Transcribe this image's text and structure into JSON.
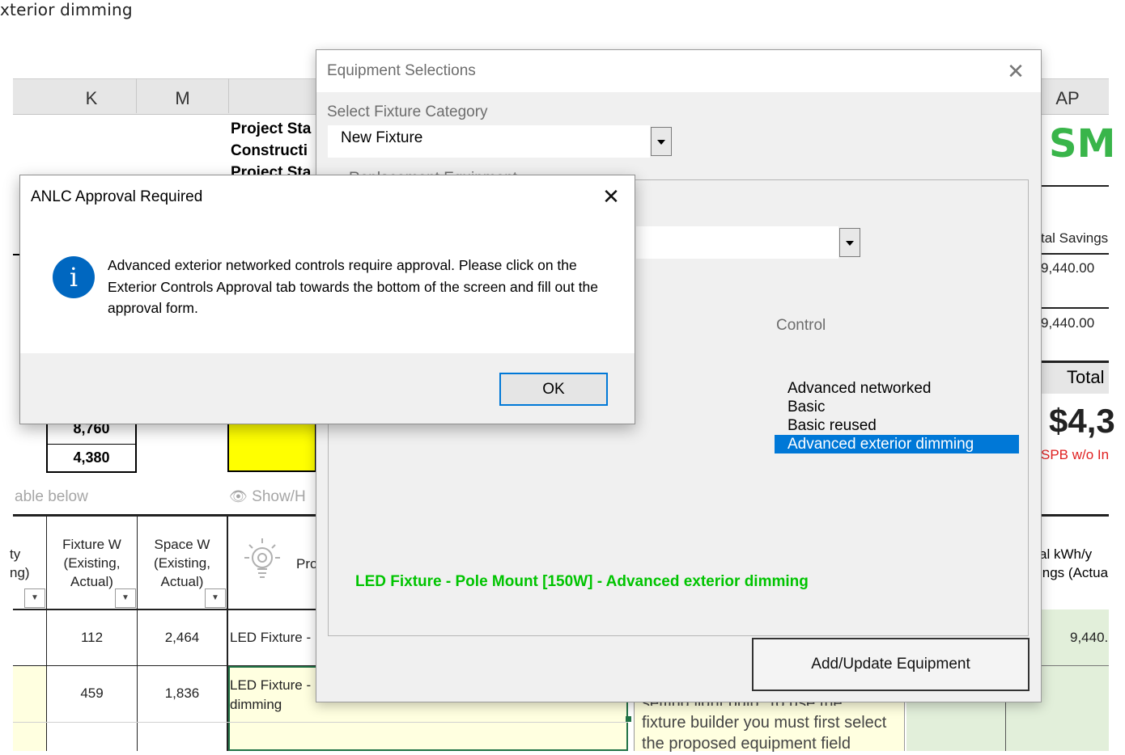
{
  "sheet": {
    "title": "xterior dimming",
    "columns": {
      "k": "K",
      "m": "M",
      "ap": "AP"
    },
    "project_labels": [
      "Project Sta",
      "Constructi",
      "Project Sta"
    ],
    "hours": [
      "8,760",
      "4,380"
    ],
    "table_note": "able below",
    "show_hide": "Show/H",
    "headers": {
      "partial_left": "ty\nng)",
      "fixture_w": "Fixture W\n(Existing,\nActual)",
      "space_w": "Space W\n(Existing,\nActual)",
      "proposed_partial": "Pro",
      "savings_partial": "al kWh/y\nings (Actua"
    },
    "rows": [
      {
        "fixture_w": "112",
        "space_w": "2,464",
        "proposed": "LED Fixture -",
        "savings": "9,440."
      },
      {
        "fixture_w": "459",
        "space_w": "1,836",
        "proposed": "LED Fixture -\ndimming",
        "savings": ""
      }
    ],
    "tooltip_note": [
      "setting light bulb. To use the",
      "fixture builder you must first select",
      "the proposed equipment field"
    ],
    "right": {
      "logo": "SM",
      "total_savings_label": "tal Savings",
      "savings_values": [
        "9,440.00",
        "9,440.00"
      ],
      "total_label": "Total",
      "total_value": "$4,3",
      "spb_label": "SPB w/o In"
    }
  },
  "equipment_dialog": {
    "title": "Equipment Selections",
    "fixture_category_label": "Select Fixture Category",
    "fixture_category_value": "New Fixture",
    "hidden_label": "Replacement Equipment",
    "control_label": "Control",
    "control_options": [
      {
        "label": "Advanced networked",
        "selected": false
      },
      {
        "label": "Basic",
        "selected": false
      },
      {
        "label": "Basic reused",
        "selected": false
      },
      {
        "label": "Advanced exterior dimming",
        "selected": true
      }
    ],
    "result_text": "LED Fixture - Pole Mount [150W] - Advanced exterior dimming",
    "add_button": "Add/Update Equipment",
    "close_glyph": "✕"
  },
  "message_box": {
    "title": "ANLC Approval Required",
    "icon": "info-icon",
    "message": "Advanced exterior networked controls require approval. Please click on the Exterior Controls Approval tab towards the bottom of the screen and fill out the approval form.",
    "ok_label": "OK",
    "close_glyph": "✕"
  },
  "colors": {
    "accent": "#0078d7",
    "result_green": "#00c400",
    "logo_green": "#39b54a",
    "spb_red": "#e02020",
    "highlight": "#ffff00"
  }
}
